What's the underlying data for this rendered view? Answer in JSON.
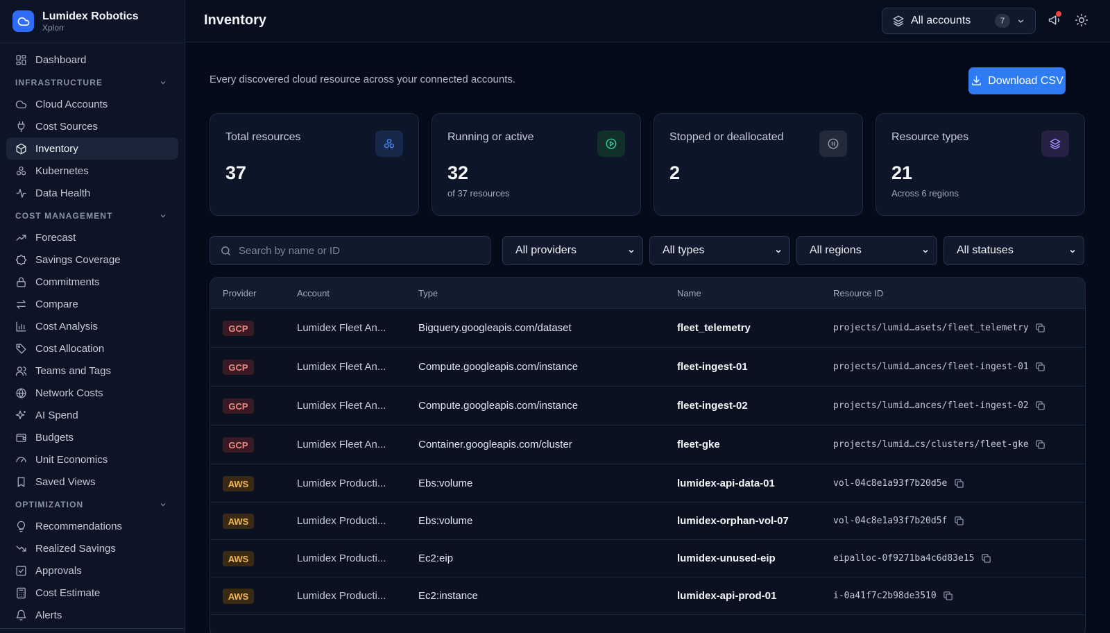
{
  "brand": {
    "name": "Lumidex Robotics",
    "subtitle": "Xplorr"
  },
  "sidebar": {
    "dashboard": "Dashboard",
    "sections": [
      {
        "title": "INFRASTRUCTURE",
        "items": [
          "Cloud Accounts",
          "Cost Sources",
          "Inventory",
          "Kubernetes",
          "Data Health"
        ]
      },
      {
        "title": "COST MANAGEMENT",
        "items": [
          "Forecast",
          "Savings Coverage",
          "Commitments",
          "Compare",
          "Cost Analysis",
          "Cost Allocation",
          "Teams and Tags",
          "Network Costs",
          "AI Spend",
          "Budgets",
          "Unit Economics",
          "Saved Views"
        ]
      },
      {
        "title": "OPTIMIZATION",
        "items": [
          "Recommendations",
          "Realized Savings",
          "Approvals",
          "Cost Estimate",
          "Alerts"
        ]
      }
    ],
    "active": "Inventory"
  },
  "header": {
    "title": "Inventory",
    "account_switch_label": "All accounts",
    "account_count": "7"
  },
  "main": {
    "subtitle": "Every discovered cloud resource across your connected accounts.",
    "download_label": "Download CSV",
    "cards": [
      {
        "label": "Total resources",
        "value": "37",
        "sub": "",
        "icon": "kubernetes-cluster-icon",
        "icon_color": "#4f8cff",
        "icon_bg": "#17284a"
      },
      {
        "label": "Running or active",
        "value": "32",
        "sub": "of 37 resources",
        "icon": "play-circle-icon",
        "icon_color": "#34d399",
        "icon_bg": "#12302a"
      },
      {
        "label": "Stopped or deallocated",
        "value": "2",
        "sub": "",
        "icon": "pause-circle-icon",
        "icon_color": "#9aa3b5",
        "icon_bg": "#232b3b"
      },
      {
        "label": "Resource types",
        "value": "21",
        "sub": "Across 6 regions",
        "icon": "layers-icon",
        "icon_color": "#a78bfa",
        "icon_bg": "#272244"
      }
    ],
    "search_placeholder": "Search by name or ID",
    "filters": [
      "All providers",
      "All types",
      "All regions",
      "All statuses"
    ]
  },
  "table": {
    "headers": [
      "Provider",
      "Account",
      "Type",
      "Name",
      "Resource ID"
    ],
    "rows": [
      {
        "provider": "GCP",
        "account": "Lumidex Fleet An...",
        "type": "Bigquery.googleapis.com/dataset",
        "name": "fleet_telemetry",
        "rid": "projects/lumid…asets/fleet_telemetry"
      },
      {
        "provider": "GCP",
        "account": "Lumidex Fleet An...",
        "type": "Compute.googleapis.com/instance",
        "name": "fleet-ingest-01",
        "rid": "projects/lumid…ances/fleet-ingest-01"
      },
      {
        "provider": "GCP",
        "account": "Lumidex Fleet An...",
        "type": "Compute.googleapis.com/instance",
        "name": "fleet-ingest-02",
        "rid": "projects/lumid…ances/fleet-ingest-02"
      },
      {
        "provider": "GCP",
        "account": "Lumidex Fleet An...",
        "type": "Container.googleapis.com/cluster",
        "name": "fleet-gke",
        "rid": "projects/lumid…cs/clusters/fleet-gke"
      },
      {
        "provider": "AWS",
        "account": "Lumidex Producti...",
        "type": "Ebs:volume",
        "name": "lumidex-api-data-01",
        "rid": "vol-04c8e1a93f7b20d5e"
      },
      {
        "provider": "AWS",
        "account": "Lumidex Producti...",
        "type": "Ebs:volume",
        "name": "lumidex-orphan-vol-07",
        "rid": "vol-04c8e1a93f7b20d5f"
      },
      {
        "provider": "AWS",
        "account": "Lumidex Producti...",
        "type": "Ec2:eip",
        "name": "lumidex-unused-eip",
        "rid": "eipalloc-0f9271ba4c6d83e15"
      },
      {
        "provider": "AWS",
        "account": "Lumidex Producti...",
        "type": "Ec2:instance",
        "name": "lumidex-api-prod-01",
        "rid": "i-0a41f7c2b98de3510"
      }
    ]
  },
  "colors": {
    "accent": "#2f7bf3",
    "background": "#050b18",
    "sidebar": "#0c1426"
  }
}
